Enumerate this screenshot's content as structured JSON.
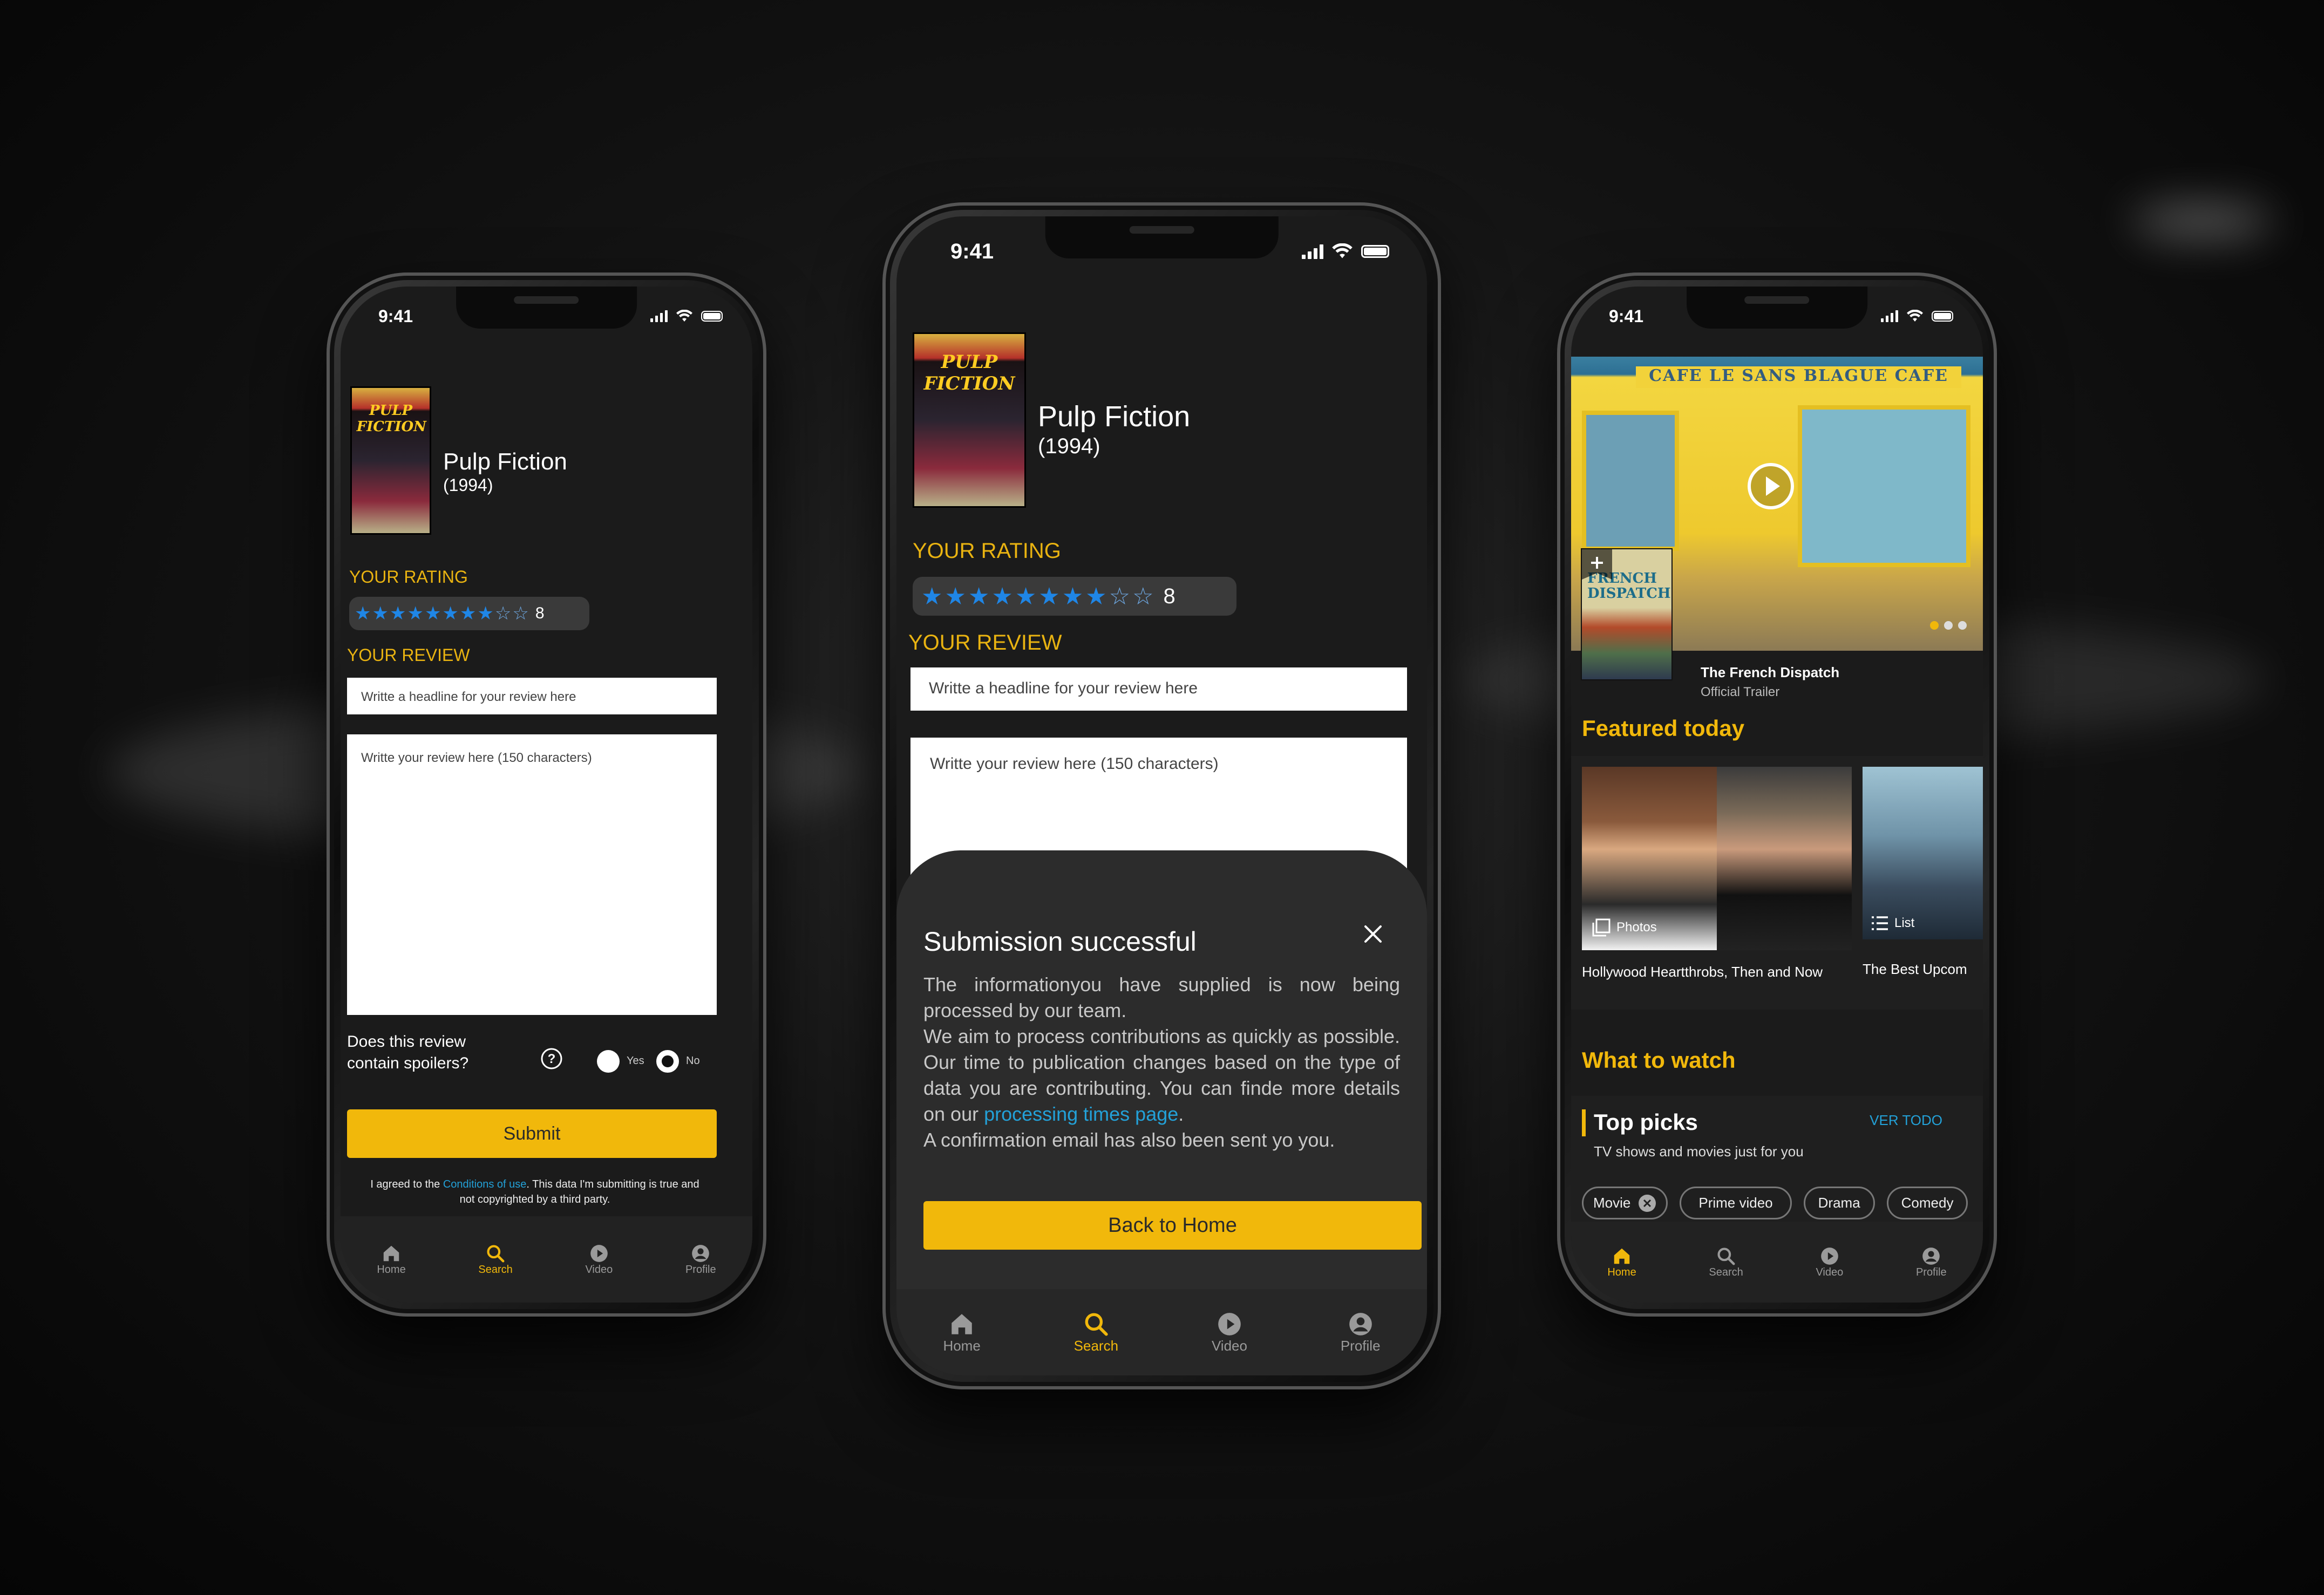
{
  "status": {
    "time": "9:41"
  },
  "movie": {
    "title": "Pulp Fiction",
    "year": "(1994)",
    "poster_text": "PULP FICTION"
  },
  "rating": {
    "label": "YOUR RATING",
    "value": "8",
    "stars_filled": 8,
    "stars_total": 10
  },
  "review": {
    "label": "YOUR REVIEW",
    "headline_placeholder": "Writte a headline for your review here",
    "body_placeholder": "Writte your review here (150 characters)",
    "spoiler_question": "Does this review contain spoilers?",
    "yes": "Yes",
    "no": "No",
    "submit": "Submit",
    "terms_prefix": "I agreed to the ",
    "terms_link": "Conditions of use",
    "terms_suffix": ". This data I'm submitting is true and not copyrighted by a third party."
  },
  "modal": {
    "title": "Submission successful",
    "body_1": "The informationyou have supplied is now being processed by our team.",
    "body_2": "We aim to process contributions as quickly as possible. Our time to publication changes based on the type of data you are contributing. You can finde more details on our ",
    "body_link": "processing times page",
    "body_3": ".",
    "body_4": "A confirmation email has also been sent yo you.",
    "button": "Back to Home"
  },
  "tabs": [
    {
      "label": "Home",
      "icon": "home-icon"
    },
    {
      "label": "Search",
      "icon": "search-icon"
    },
    {
      "label": "Video",
      "icon": "play-icon"
    },
    {
      "label": "Profile",
      "icon": "profile-icon"
    }
  ],
  "home": {
    "hero_sign": "CAFE LE SANS BLAGUE CAFE",
    "hero_title": "The French Dispatch",
    "hero_subtitle": "Official Trailer",
    "hero_poster_text": "FRENCH DISPATCH",
    "featured_label": "Featured today",
    "card1_badge": "Photos",
    "card1_caption": "Hollywood Heartthrobs, Then and Now",
    "card2_badge": "List",
    "card2_caption": "The Best Upcom",
    "what_to_watch": "What to watch",
    "top_picks": "Top picks",
    "top_picks_sub": "TV shows and movies just for you",
    "see_all": "VER TODO",
    "chips": [
      "Movie",
      "Prime video",
      "Drama",
      "Comedy"
    ]
  },
  "colors": {
    "accent": "#f1b80b",
    "star": "#1f86e6",
    "link": "#23a1d8",
    "screen_bg": "#1b1b1b"
  }
}
